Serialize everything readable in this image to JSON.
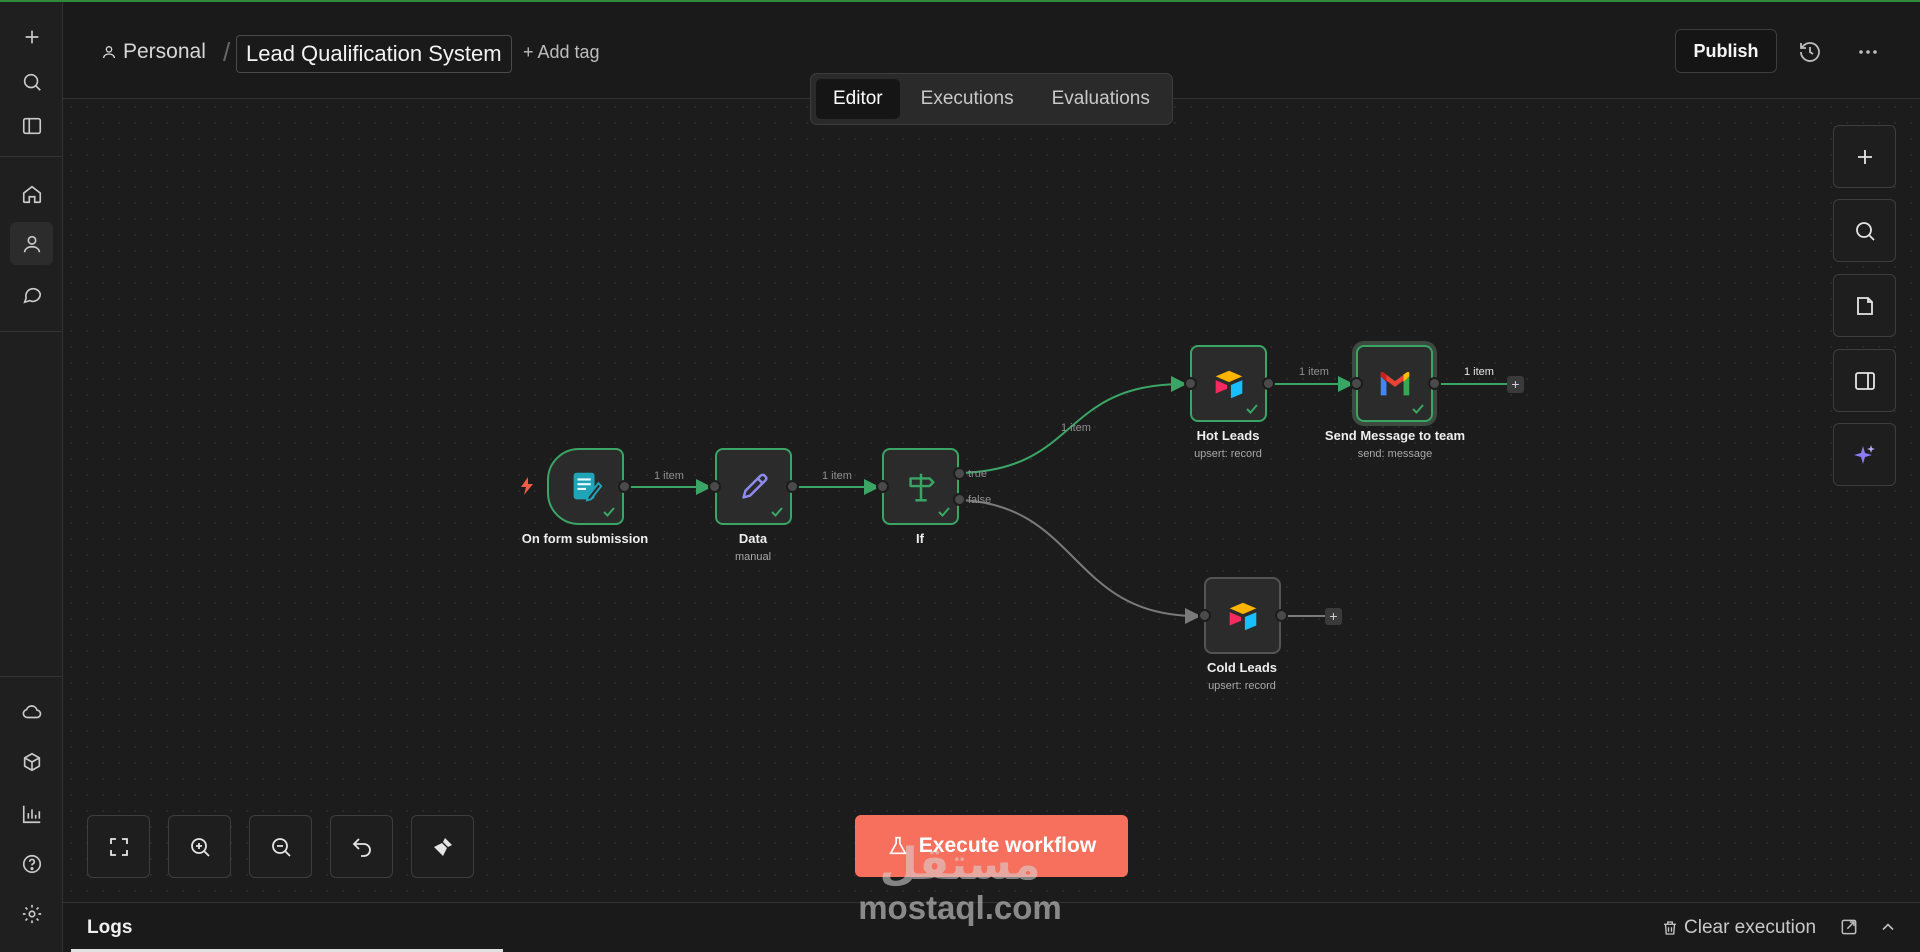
{
  "header": {
    "breadcrumb_owner": "Personal",
    "workflow_name": "Lead Qualification System",
    "add_tag": "+ Add tag",
    "publish": "Publish"
  },
  "tabs": [
    {
      "label": "Editor",
      "active": true
    },
    {
      "label": "Executions",
      "active": false
    },
    {
      "label": "Evaluations",
      "active": false
    }
  ],
  "sidebar": {
    "top_icons": [
      "plus-icon",
      "search-icon",
      "panel-icon"
    ],
    "nav_icons": [
      "home-icon",
      "user-icon",
      "chat-icon"
    ],
    "bottom_icons": [
      "cloud-icon",
      "templates-icon",
      "insights-icon",
      "help-icon",
      "settings-icon"
    ],
    "active": "user-icon"
  },
  "nodes": {
    "form": {
      "label": "On form submission",
      "subtitle": "",
      "icon": "form-icon"
    },
    "data": {
      "label": "Data",
      "subtitle": "manual",
      "icon": "pencil-icon"
    },
    "if": {
      "label": "If",
      "subtitle": "",
      "icon": "signpost-icon"
    },
    "hot": {
      "label": "Hot Leads",
      "subtitle": "upsert: record",
      "icon": "airtable-icon"
    },
    "send": {
      "label": "Send Message to team",
      "subtitle": "send: message",
      "icon": "gmail-icon"
    },
    "cold": {
      "label": "Cold Leads",
      "subtitle": "upsert: record",
      "icon": "airtable-icon"
    }
  },
  "edges": {
    "form_data": "1 item",
    "data_if": "1 item",
    "if_hot": "1 item",
    "hot_send": "1 item",
    "send_out": "1 item",
    "if_true": "true",
    "if_false": "false"
  },
  "controls": {
    "execute": "Execute workflow",
    "zoom_buttons": [
      "fit-view-icon",
      "zoom-in-icon",
      "zoom-out-icon",
      "undo-icon",
      "tidy-up-icon"
    ],
    "right_tools": [
      "add-node-icon",
      "search-icon",
      "sticky-note-icon",
      "panel-icon",
      "ai-sparkle-icon"
    ]
  },
  "logs": {
    "title": "Logs",
    "clear": "Clear execution"
  },
  "watermark": {
    "logo": "مستقل",
    "text": "mostaql.com"
  },
  "colors": {
    "success": "#3aa564",
    "execute": "#f7705e",
    "trigger_bolt": "#f25c45"
  }
}
